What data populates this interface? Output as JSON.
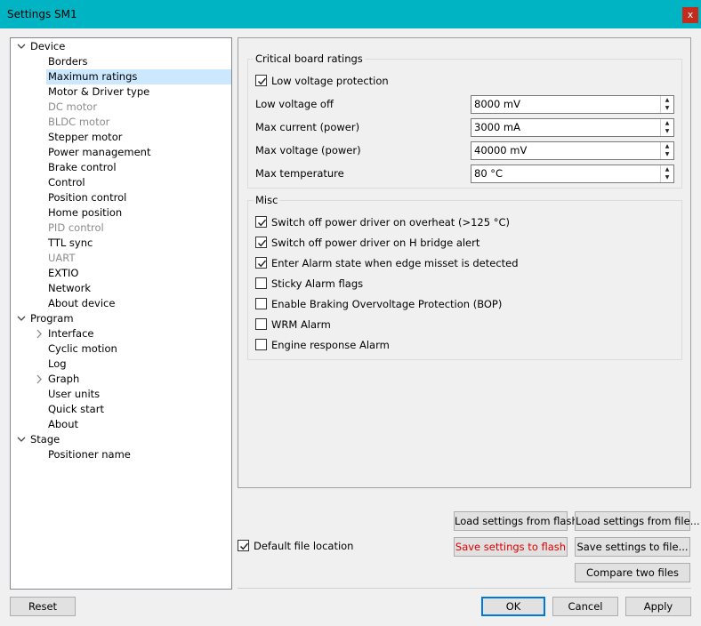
{
  "window": {
    "title": "Settings SM1",
    "close_label": "x"
  },
  "tree": {
    "items": [
      {
        "label": "Device",
        "level": 0,
        "expander": "expanded",
        "disabled": false,
        "selected": false
      },
      {
        "label": "Borders",
        "level": 1,
        "expander": "none",
        "disabled": false,
        "selected": false
      },
      {
        "label": "Maximum ratings",
        "level": 1,
        "expander": "none",
        "disabled": false,
        "selected": true
      },
      {
        "label": "Motor & Driver type",
        "level": 1,
        "expander": "none",
        "disabled": false,
        "selected": false
      },
      {
        "label": "DC motor",
        "level": 1,
        "expander": "none",
        "disabled": true,
        "selected": false
      },
      {
        "label": "BLDC motor",
        "level": 1,
        "expander": "none",
        "disabled": true,
        "selected": false
      },
      {
        "label": "Stepper motor",
        "level": 1,
        "expander": "none",
        "disabled": false,
        "selected": false
      },
      {
        "label": "Power management",
        "level": 1,
        "expander": "none",
        "disabled": false,
        "selected": false
      },
      {
        "label": "Brake control",
        "level": 1,
        "expander": "none",
        "disabled": false,
        "selected": false
      },
      {
        "label": "Control",
        "level": 1,
        "expander": "none",
        "disabled": false,
        "selected": false
      },
      {
        "label": "Position control",
        "level": 1,
        "expander": "none",
        "disabled": false,
        "selected": false
      },
      {
        "label": "Home position",
        "level": 1,
        "expander": "none",
        "disabled": false,
        "selected": false
      },
      {
        "label": "PID control",
        "level": 1,
        "expander": "none",
        "disabled": true,
        "selected": false
      },
      {
        "label": "TTL sync",
        "level": 1,
        "expander": "none",
        "disabled": false,
        "selected": false
      },
      {
        "label": "UART",
        "level": 1,
        "expander": "none",
        "disabled": true,
        "selected": false
      },
      {
        "label": "EXTIO",
        "level": 1,
        "expander": "none",
        "disabled": false,
        "selected": false
      },
      {
        "label": "Network",
        "level": 1,
        "expander": "none",
        "disabled": false,
        "selected": false
      },
      {
        "label": "About device",
        "level": 1,
        "expander": "none",
        "disabled": false,
        "selected": false
      },
      {
        "label": "Program",
        "level": 0,
        "expander": "expanded",
        "disabled": false,
        "selected": false
      },
      {
        "label": "Interface",
        "level": 1,
        "expander": "collapsed",
        "disabled": false,
        "selected": false
      },
      {
        "label": "Cyclic motion",
        "level": 1,
        "expander": "none",
        "disabled": false,
        "selected": false
      },
      {
        "label": "Log",
        "level": 1,
        "expander": "none",
        "disabled": false,
        "selected": false
      },
      {
        "label": "Graph",
        "level": 1,
        "expander": "collapsed",
        "disabled": false,
        "selected": false
      },
      {
        "label": "User units",
        "level": 1,
        "expander": "none",
        "disabled": false,
        "selected": false
      },
      {
        "label": "Quick start",
        "level": 1,
        "expander": "none",
        "disabled": false,
        "selected": false
      },
      {
        "label": "About",
        "level": 1,
        "expander": "none",
        "disabled": false,
        "selected": false
      },
      {
        "label": "Stage",
        "level": 0,
        "expander": "expanded",
        "disabled": false,
        "selected": false
      },
      {
        "label": "Positioner name",
        "level": 1,
        "expander": "none",
        "disabled": false,
        "selected": false
      }
    ]
  },
  "critical": {
    "title": "Critical board ratings",
    "low_voltage_protection": {
      "label": "Low voltage protection",
      "checked": true
    },
    "fields": [
      {
        "label": "Low voltage off",
        "value": "8000 mV"
      },
      {
        "label": "Max current (power)",
        "value": "3000 mA"
      },
      {
        "label": "Max voltage (power)",
        "value": "40000 mV"
      },
      {
        "label": "Max temperature",
        "value": "80 °C"
      }
    ]
  },
  "misc": {
    "title": "Misc",
    "options": [
      {
        "label": "Switch off power driver on overheat (>125 °C)",
        "checked": true
      },
      {
        "label": "Switch off power driver on H bridge alert",
        "checked": true
      },
      {
        "label": "Enter Alarm state when edge misset is detected",
        "checked": true
      },
      {
        "label": "Sticky Alarm flags",
        "checked": false
      },
      {
        "label": "Enable Braking Overvoltage Protection (BOP)",
        "checked": false
      },
      {
        "label": "WRM Alarm",
        "checked": false
      },
      {
        "label": "Engine response Alarm",
        "checked": false
      }
    ]
  },
  "file_actions": {
    "default_location": {
      "label": "Default file location",
      "checked": true
    },
    "load_flash": "Load settings from flash",
    "load_file": "Load settings from file...",
    "save_flash": "Save settings to flash",
    "save_file": "Save settings to file...",
    "compare": "Compare two files"
  },
  "footer": {
    "reset": "Reset",
    "ok": "OK",
    "cancel": "Cancel",
    "apply": "Apply"
  },
  "colors": {
    "titlebar": "#00b4c4",
    "selection": "#cce8ff",
    "focus_border": "#0078d7",
    "save_flash_text": "#e00000"
  }
}
